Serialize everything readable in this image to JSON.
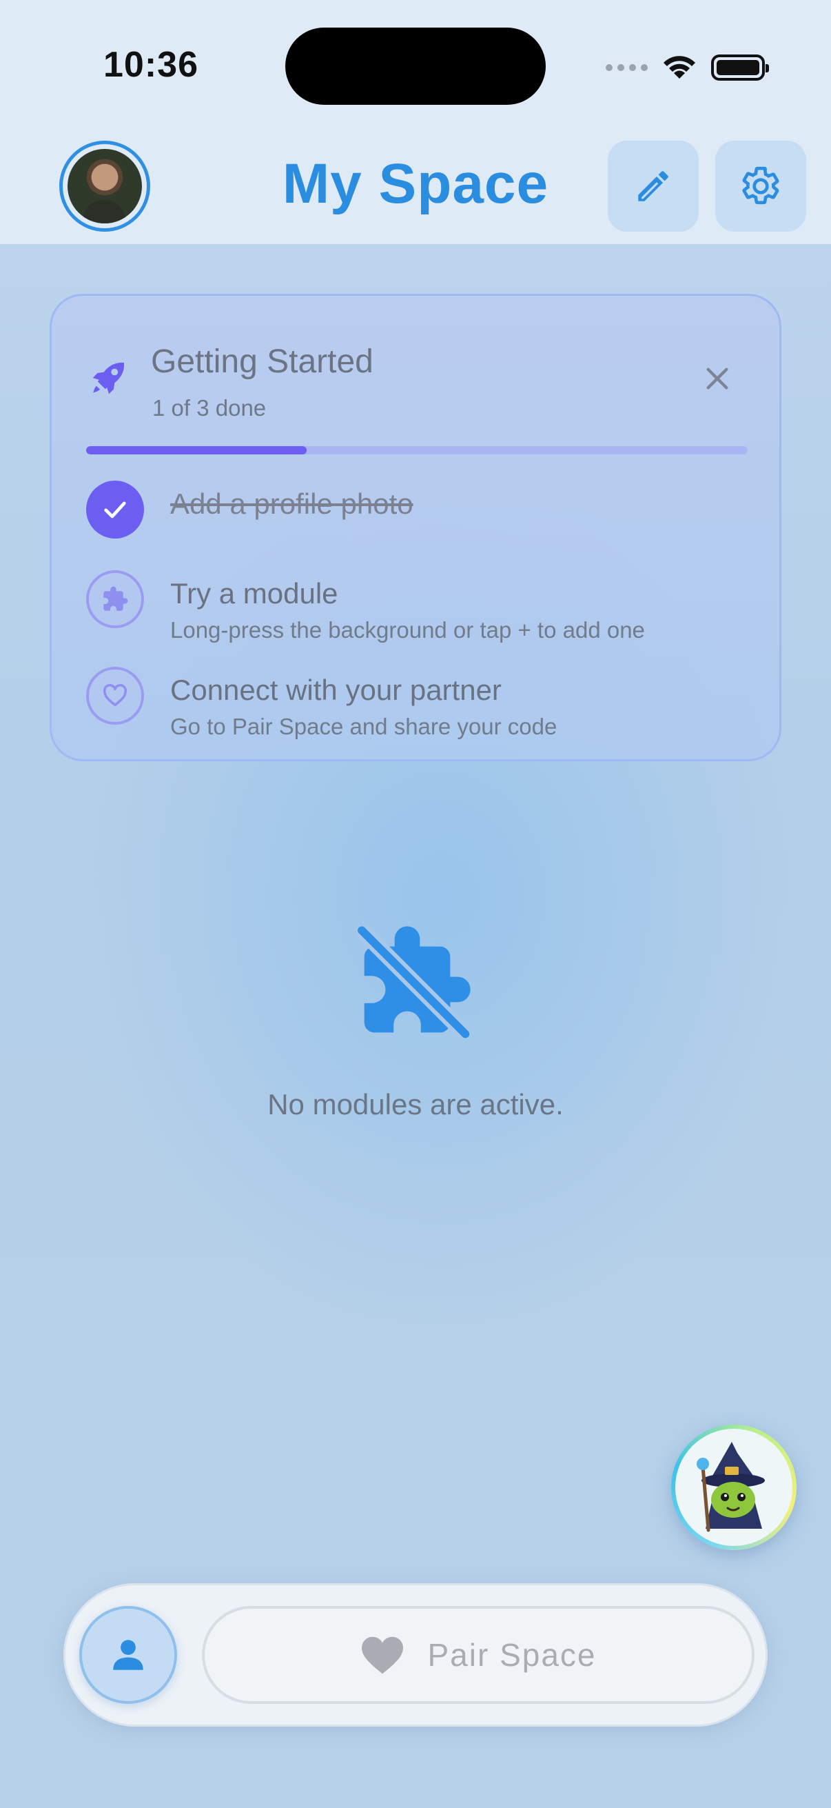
{
  "status_bar": {
    "time": "10:36"
  },
  "header": {
    "title": "My Space"
  },
  "getting_started": {
    "title": "Getting Started",
    "progress_text": "1 of 3 done",
    "progress_fraction": 0.333,
    "tasks": [
      {
        "title": "Add a profile photo",
        "subtitle": "",
        "done": true
      },
      {
        "title": "Try a module",
        "subtitle": "Long-press the background or tap + to add one",
        "done": false
      },
      {
        "title": "Connect with your partner",
        "subtitle": "Go to Pair Space and share your code",
        "done": false
      }
    ]
  },
  "empty_state": {
    "message": "No modules are active."
  },
  "bottom_nav": {
    "pair_label": "Pair Space"
  },
  "colors": {
    "accent_blue": "#2a8de0",
    "accent_purple": "#6b5ef0"
  }
}
